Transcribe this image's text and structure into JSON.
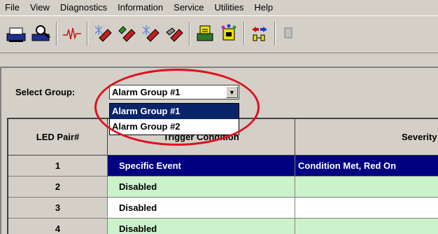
{
  "menu": [
    "File",
    "View",
    "Diagnostics",
    "Information",
    "Service",
    "Utilities",
    "Help"
  ],
  "toolbar": {
    "icons": [
      "print-icon",
      "print-preview-icon",
      "waveform-icon",
      "erase-1-icon",
      "erase-2-icon",
      "erase-3-icon",
      "erase-4-icon",
      "report-icon",
      "module-icon",
      "transfer-icon"
    ]
  },
  "select_group": {
    "label": "Select Group:",
    "value": "Alarm Group #1",
    "options": [
      "Alarm Group #1",
      "Alarm Group #2"
    ],
    "selected_index": 0
  },
  "table": {
    "headers": [
      "LED Pair#",
      "Trigger Condition",
      "Severity"
    ],
    "rows": [
      {
        "led": "1",
        "trigger": "Specific Event",
        "severity": "Condition Met, Red On"
      },
      {
        "led": "2",
        "trigger": "Disabled",
        "severity": ""
      },
      {
        "led": "3",
        "trigger": "Disabled",
        "severity": ""
      },
      {
        "led": "4",
        "trigger": "Disabled",
        "severity": ""
      }
    ]
  },
  "colors": {
    "selected_row": "#000080",
    "alt_row": "#ccf2cc",
    "annotation_ring": "#e01020"
  }
}
